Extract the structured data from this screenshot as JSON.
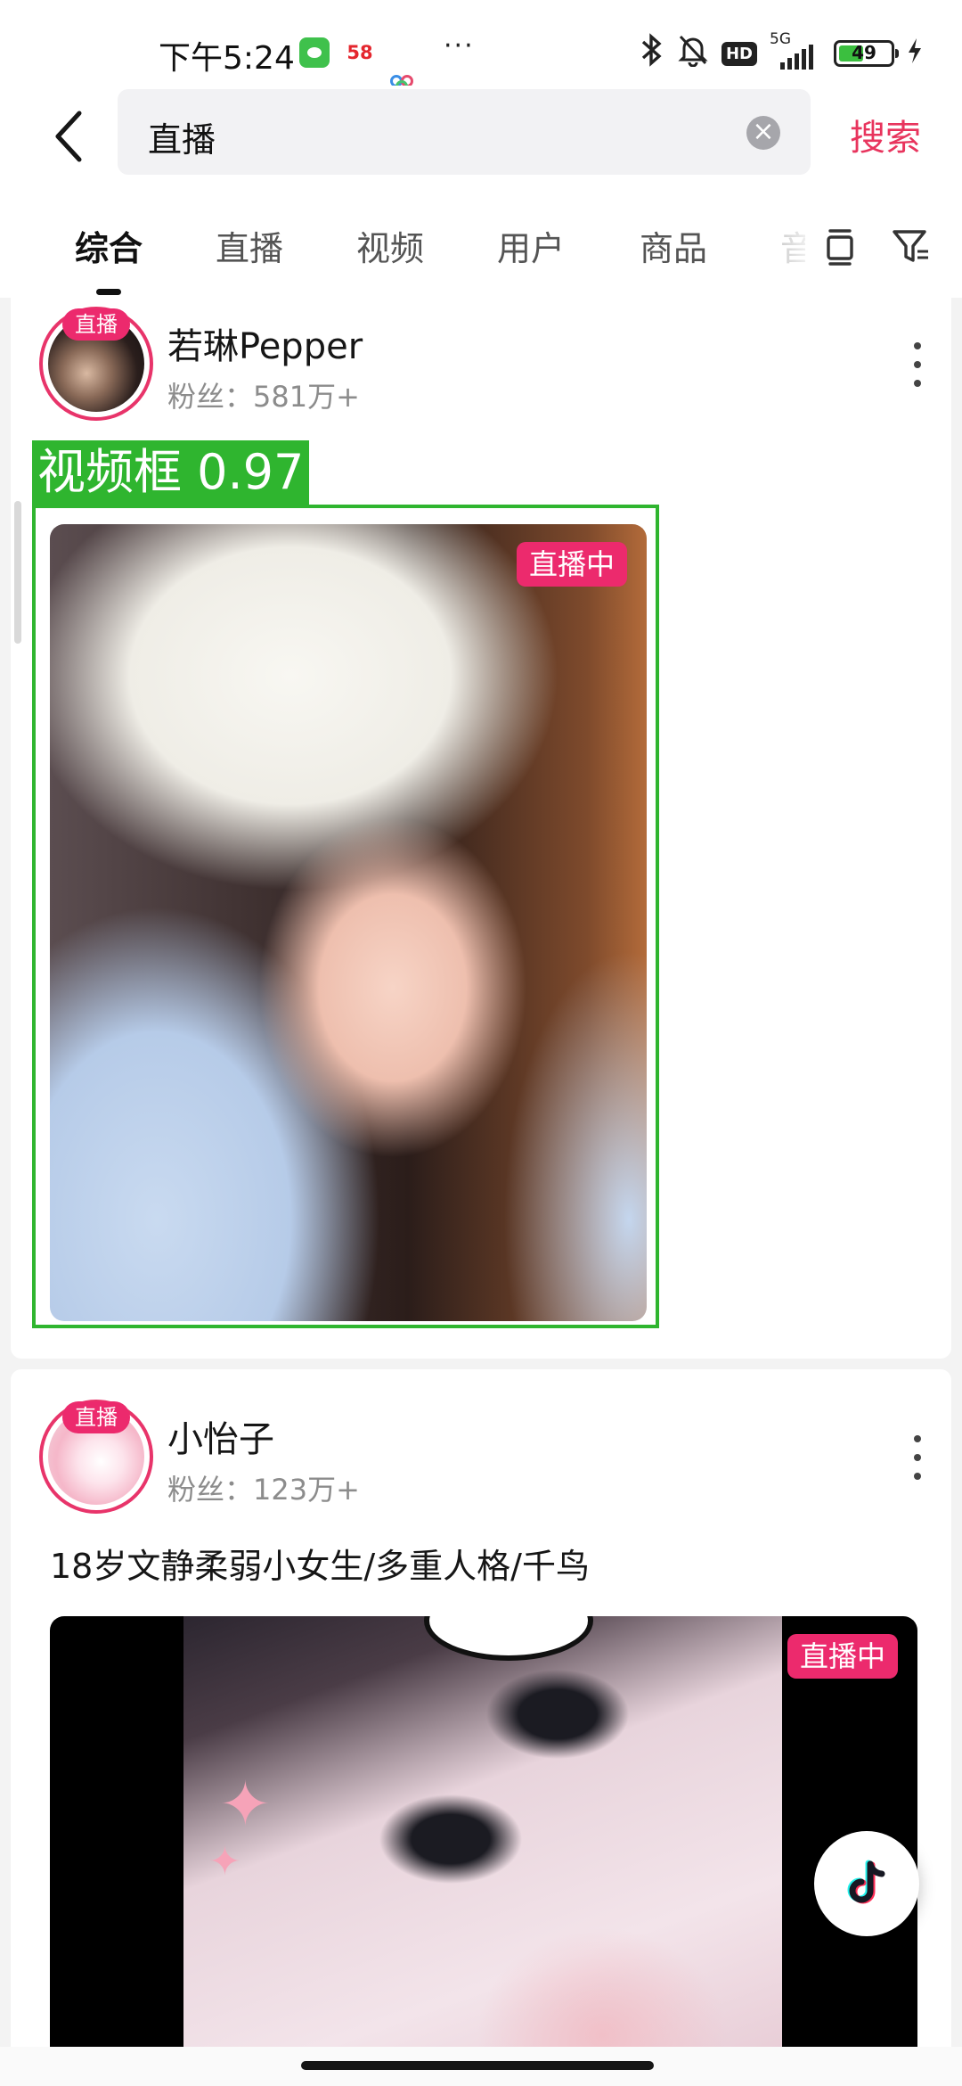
{
  "status_bar": {
    "time": "下午5:24",
    "fifty8_label": "58",
    "more_dots": "···",
    "network": "5G",
    "hd": "HD",
    "battery": "49",
    "battery_level": 0.49
  },
  "search": {
    "query": "直播",
    "submit_label": "搜索"
  },
  "tabs": [
    {
      "label": "综合",
      "active": true
    },
    {
      "label": "直播"
    },
    {
      "label": "视频"
    },
    {
      "label": "用户"
    },
    {
      "label": "商品"
    },
    {
      "label": "音"
    }
  ],
  "results": [
    {
      "live_chip": "直播",
      "name": "若琳Pepper",
      "fans": "粉丝：581万+",
      "cover_badge": "直播中"
    },
    {
      "live_chip": "直播",
      "name": "小怡子",
      "fans": "粉丝：123万+",
      "bio": "18岁文静柔弱小女生/多重人格/千鸟",
      "cover_badge": "直播中"
    }
  ],
  "detection": {
    "label": "视频框 0.97",
    "color": "#2fb52f"
  },
  "colors": {
    "accent": "#e8345d",
    "live": "#ec2a6d"
  }
}
